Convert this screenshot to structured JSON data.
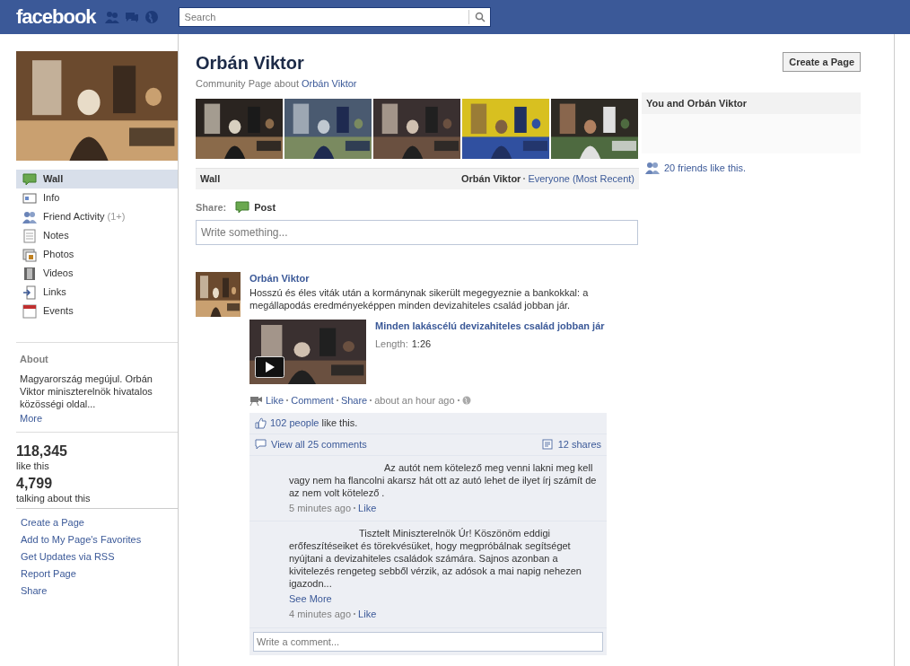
{
  "header": {
    "logo": "facebook",
    "search": {
      "placeholder": "Search"
    }
  },
  "sidebar": {
    "nav": [
      {
        "label": "Wall",
        "kind": "wall",
        "selected": true
      },
      {
        "label": "Info",
        "kind": "info",
        "selected": false
      },
      {
        "label": "Friend Activity",
        "count": "(1+)",
        "kind": "friends",
        "selected": false
      },
      {
        "label": "Notes",
        "kind": "notes",
        "selected": false
      },
      {
        "label": "Photos",
        "kind": "photos",
        "selected": false
      },
      {
        "label": "Videos",
        "kind": "videos",
        "selected": false
      },
      {
        "label": "Links",
        "kind": "links",
        "selected": false
      },
      {
        "label": "Events",
        "kind": "events",
        "selected": false
      }
    ],
    "about": {
      "title": "About",
      "text": "Magyarország megújul. Orbán Viktor miniszterelnök hivatalos közösségi oldal...",
      "more": "More"
    },
    "stats": [
      {
        "value": "118,345",
        "label": "like this"
      },
      {
        "value": "4,799",
        "label": "talking about this"
      }
    ],
    "links": [
      "Create a Page",
      "Add to My Page's Favorites",
      "Get Updates via RSS",
      "Report Page",
      "Share"
    ]
  },
  "page": {
    "title": "Orbán Viktor",
    "subtitle": "Community Page about",
    "subtitle_link": "Orbán Viktor",
    "create_button": "Create a Page"
  },
  "wall_bar": {
    "title": "Wall",
    "author": "Orbán Viktor",
    "filter": "Everyone (Most Recent)"
  },
  "share": {
    "label": "Share:",
    "post": "Post",
    "placeholder": "Write something..."
  },
  "post": {
    "author": "Orbán Viktor",
    "text": "Hosszú és éles viták után a kormánynak sikerült megegyeznie a bankokkal: a megállapodás eredményeképpen minden devizahiteles család jobban jár.",
    "video": {
      "title": "Minden lakáscélú devizahiteles család jobban jár",
      "length_label": "Length:",
      "length": "1:26"
    },
    "actions": [
      "Like",
      "Comment",
      "Share"
    ],
    "time": "about an hour ago",
    "likes": {
      "link": "102 people",
      "text": "like this."
    },
    "view_comments": "View all 25 comments",
    "shares": "12 shares",
    "comments": [
      {
        "text": "Az autót nem kötelező meg venni lakni meg kell vagy nem ha flancolni akarsz hát ott az autó lehet de ilyet írj számít de az nem volt kötelező .",
        "time": "5 minutes ago",
        "like": "Like"
      },
      {
        "text": "Tisztelt Miniszterelnök Úr! Köszönöm eddigi erőfeszítéseiket és törekvésüket, hogy megpróbálnak segítséget nyújtani a devizahiteles családok számára. Sajnos azonban a kivitelezés rengeteg sebből vérzik, az adósok a mai napig nehezen igazodn...",
        "see_more": "See More",
        "time": "4 minutes ago",
        "like": "Like"
      }
    ],
    "comment_placeholder": "Write a comment..."
  },
  "right": {
    "heading": "You and Orbán Viktor",
    "friends": "20 friends like this."
  }
}
